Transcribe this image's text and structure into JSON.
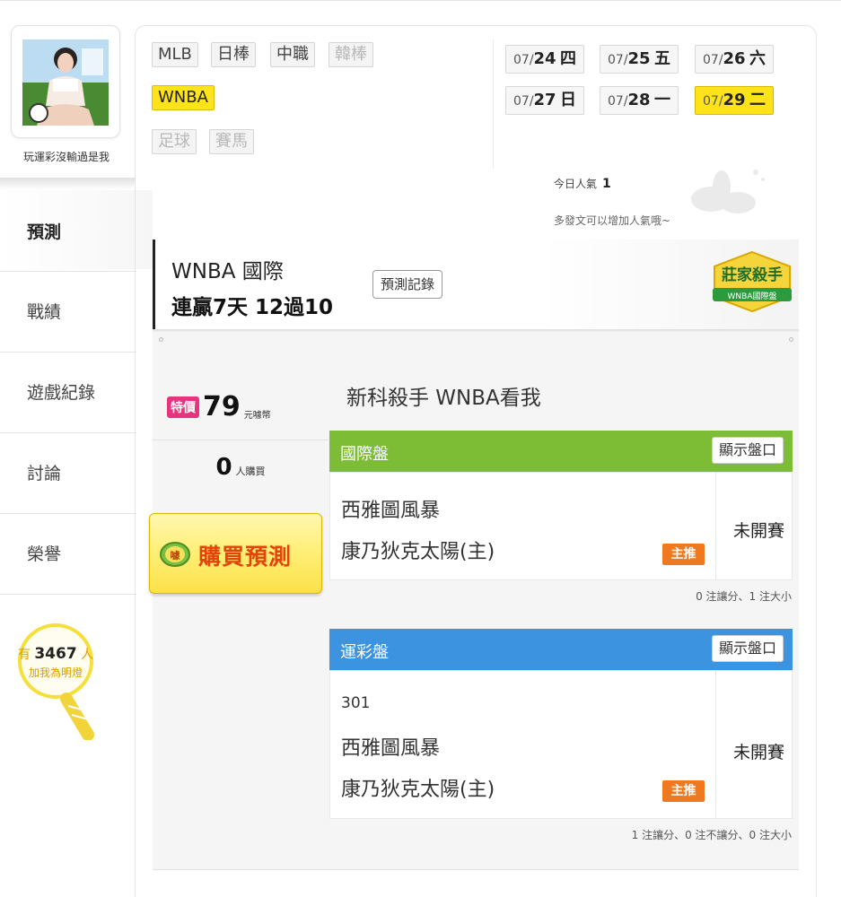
{
  "profile": {
    "nickname": "玩運彩沒輸過是我"
  },
  "nav": {
    "active": "預測",
    "items": [
      "戰績",
      "遊戲紀錄",
      "討論",
      "榮譽"
    ]
  },
  "fans": {
    "prefix": "有",
    "count": "3467",
    "suffix": "人",
    "label": "加我為明燈"
  },
  "sports": [
    {
      "label": "MLB",
      "state": "normal"
    },
    {
      "label": "日棒",
      "state": "normal"
    },
    {
      "label": "中職",
      "state": "normal"
    },
    {
      "label": "韓棒",
      "state": "disabled"
    },
    {
      "label": "WNBA",
      "state": "selected"
    },
    {
      "label": "足球",
      "state": "disabled"
    },
    {
      "label": "賽馬",
      "state": "disabled"
    }
  ],
  "dates": [
    {
      "md": "07/",
      "day": "24",
      "wd": "四",
      "selected": false
    },
    {
      "md": "07/",
      "day": "25",
      "wd": "五",
      "selected": false
    },
    {
      "md": "07/",
      "day": "26",
      "wd": "六",
      "selected": false
    },
    {
      "md": "07/",
      "day": "27",
      "wd": "日",
      "selected": false
    },
    {
      "md": "07/",
      "day": "28",
      "wd": "一",
      "selected": false
    },
    {
      "md": "07/",
      "day": "29",
      "wd": "二",
      "selected": true
    }
  ],
  "popularity": {
    "label": "今日人氣",
    "value": "1",
    "hint": "多發文可以增加人氣哦~"
  },
  "prediction_header": {
    "league": "WNBA 國際",
    "streak": "連贏7天 12過10",
    "history_button": "預測記錄",
    "badge_title": "莊家殺手",
    "badge_sub": "WNBA國際盤"
  },
  "offer": {
    "price_tag": "特價",
    "price": "79",
    "price_unit": "元噱幣",
    "buyers": "0",
    "buyers_label": "人購買",
    "buy_coin": "噱",
    "buy_label": "購買預測"
  },
  "post_title": "新科殺手 WNBA看我",
  "markets": [
    {
      "name": "國際盤",
      "show_odds": "顯示盤口",
      "game_no": "",
      "away": "西雅圖風暴",
      "home": "康乃狄克太陽(主)",
      "pick": "主推",
      "status": "未開賽",
      "summary": "0 注讓分、1 注大小",
      "color": "#7cbd35"
    },
    {
      "name": "運彩盤",
      "show_odds": "顯示盤口",
      "game_no": "301",
      "away": "西雅圖風暴",
      "home": "康乃狄克太陽(主)",
      "pick": "主推",
      "status": "未開賽",
      "summary": "1 注讓分、0 注不讓分、0 注大小",
      "color": "#3c94e0"
    }
  ]
}
